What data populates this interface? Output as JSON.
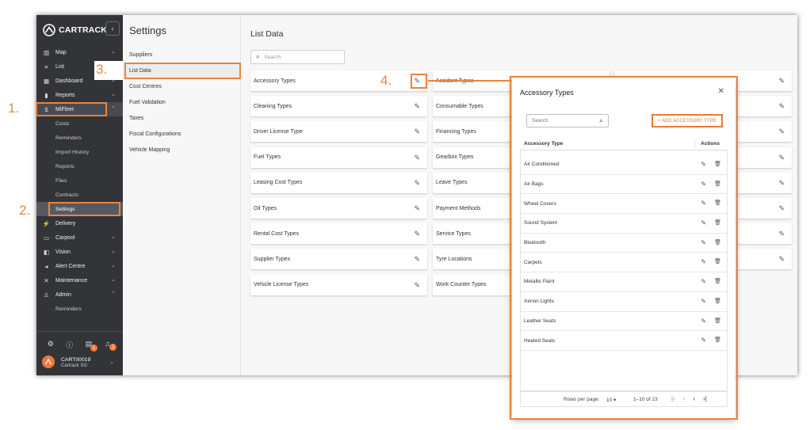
{
  "sidebar": {
    "brand": "CARTRACK",
    "nav": [
      {
        "label": "Map",
        "icon": "map-icon",
        "glyph": "▥",
        "chevron": "⌄"
      },
      {
        "label": "List",
        "icon": "list-icon",
        "glyph": "≡",
        "chevron": ""
      },
      {
        "label": "Dashboard",
        "icon": "dashboard-icon",
        "glyph": "▦",
        "chevron": "⌄"
      },
      {
        "label": "Reports",
        "icon": "reports-icon",
        "glyph": "▮",
        "chevron": "⌄"
      },
      {
        "label": "MiFleet",
        "icon": "dollar-icon",
        "glyph": "$",
        "chevron": "⌃"
      }
    ],
    "mifleet_sub": [
      "Costs",
      "Reminders",
      "Import History",
      "Reports",
      "Files",
      "Contracts",
      "Settings"
    ],
    "nav2": [
      {
        "label": "Delivery",
        "icon": "delivery-icon",
        "glyph": "⚡",
        "chevron": ""
      },
      {
        "label": "Carpool",
        "icon": "carpool-icon",
        "glyph": "▭",
        "chevron": "⌄"
      },
      {
        "label": "Vision",
        "icon": "vision-icon",
        "glyph": "◧",
        "chevron": "⌄"
      },
      {
        "label": "Alert Centre",
        "icon": "alert-icon",
        "glyph": "◂",
        "chevron": "⌄"
      },
      {
        "label": "Maintenance",
        "icon": "wrench-icon",
        "glyph": "✕",
        "chevron": "⌄"
      },
      {
        "label": "Admin",
        "icon": "admin-icon",
        "glyph": "♙",
        "chevron": "⌃"
      }
    ],
    "admin_sub": [
      "Reminders"
    ],
    "badges": {
      "notifications": "1",
      "alerts": "2"
    },
    "user": {
      "id": "CART00019",
      "org": "Cartrack SG"
    }
  },
  "settings": {
    "title": "Settings",
    "items": [
      "Suppliers",
      "List Data",
      "Cost Centres",
      "Fuel Validation",
      "Taxes",
      "Fiscal Configurations",
      "Vehicle Mapping"
    ]
  },
  "main": {
    "title": "List Data",
    "search_placeholder": "Search",
    "col1": [
      "Accessory Types",
      "Cleaning Types",
      "Driver License Type",
      "Fuel Types",
      "Leasing Cost Types",
      "Oil Types",
      "Rental Cost Types",
      "Supplier Types",
      "Vehicle License Types"
    ],
    "col2": [
      "Accident Types",
      "Consumable Types",
      "Financing Types",
      "Gearbox Types",
      "Leave Types",
      "Payment Methods",
      "Service Types",
      "Tyre Locations",
      "Work Counter Types"
    ]
  },
  "modal": {
    "title": "Accessory Types",
    "search_placeholder": "Search",
    "add_label": "+ ADD ACCESSORY TYPE",
    "col_type": "Accessory Type",
    "col_actions": "Actions",
    "rows": [
      "Air Conditioned",
      "Air Bags",
      "Wheel Covers",
      "Sound System",
      "Bluetooth",
      "Carpets",
      "Metallic Paint",
      "Xenon Lights",
      "Leather Seats",
      "Heated Seats"
    ],
    "rows_per_page_label": "Rows per page:",
    "rows_per_page": "10 ▾",
    "range": "1–10 of 23"
  },
  "annotations": {
    "s1": "1.",
    "s2": "2.",
    "s3": "3.",
    "s4": "4."
  },
  "colors": {
    "accent": "#e9843f",
    "sidebar": "#333438"
  }
}
